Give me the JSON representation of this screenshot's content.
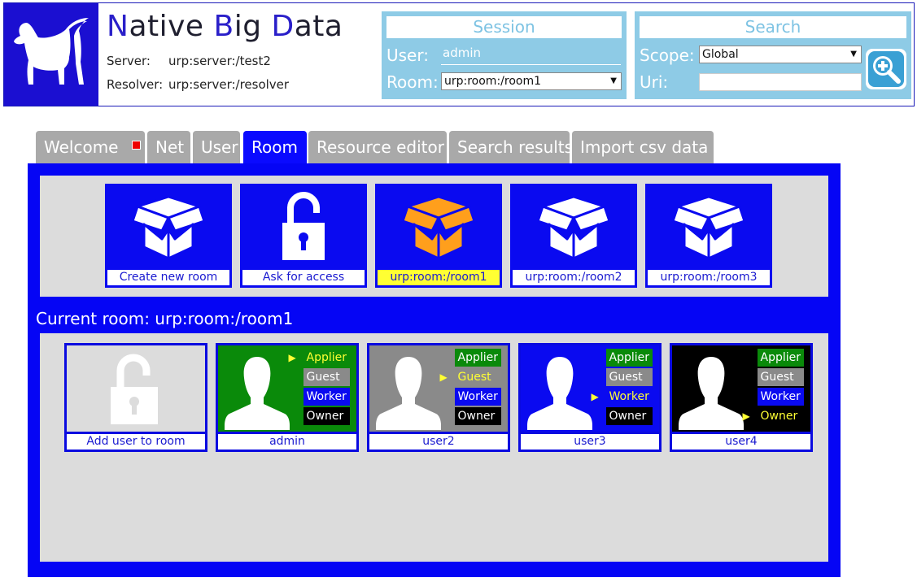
{
  "header": {
    "title_parts": [
      "N",
      "ative ",
      "B",
      "ig ",
      "D",
      "ata"
    ],
    "server_label": "Server:",
    "server_value": "urp:server:/test2",
    "resolver_label": "Resolver:",
    "resolver_value": "urp:server:/resolver"
  },
  "session": {
    "title": "Session",
    "user_label": "User:",
    "user_value": "admin",
    "room_label": "Room:",
    "room_value": "urp:room:/room1"
  },
  "search": {
    "title": "Search",
    "scope_label": "Scope:",
    "scope_value": "Global",
    "uri_label": "Uri:",
    "uri_value": ""
  },
  "tabs": [
    {
      "label": "Welcome"
    },
    {
      "label": "Net"
    },
    {
      "label": "User"
    },
    {
      "label": "Room"
    },
    {
      "label": "Resource editor"
    },
    {
      "label": "Search results"
    },
    {
      "label": "Import csv data"
    }
  ],
  "rooms": [
    {
      "label": "Create new room",
      "icon": "box-icon"
    },
    {
      "label": "Ask for access",
      "icon": "unlock-icon"
    },
    {
      "label": "urp:room:/room1",
      "icon": "box-icon",
      "selected": true
    },
    {
      "label": "urp:room:/room2",
      "icon": "box-icon"
    },
    {
      "label": "urp:room:/room3",
      "icon": "box-icon"
    }
  ],
  "current_room_text": "Current room: urp:room:/room1",
  "users": [
    {
      "label": "Add user to room"
    },
    {
      "label": "admin",
      "bg": "#0a8a0a",
      "role": "Applier"
    },
    {
      "label": "user2",
      "bg": "#8a8a8a",
      "role": "Guest"
    },
    {
      "label": "user3",
      "bg": "#0a0af0",
      "role": "Worker"
    },
    {
      "label": "user4",
      "bg": "#000000",
      "role": "Owner"
    }
  ],
  "role_names": [
    "Applier",
    "Guest",
    "Worker",
    "Owner"
  ],
  "colors": {
    "primary_blue": "#0505f5",
    "logo_blue": "#1b0fd1",
    "panel_blue": "#8ecbe6",
    "highlight": "#ffff33"
  }
}
